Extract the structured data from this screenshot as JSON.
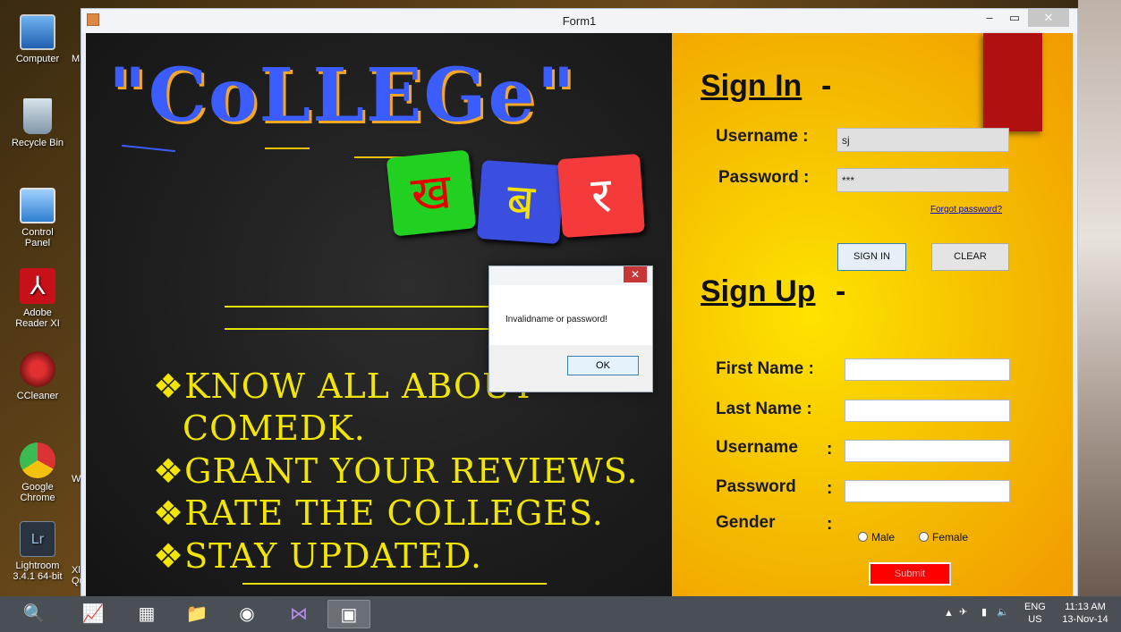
{
  "desktop": {
    "icons": [
      {
        "label": "Computer"
      },
      {
        "label": "Recycle Bin"
      },
      {
        "label": "Control Panel"
      },
      {
        "label": "Adobe Reader XI"
      },
      {
        "label": "CCleaner"
      },
      {
        "label": "Google Chrome"
      },
      {
        "label": "Lightroom 3.4.1 64-bit"
      }
    ],
    "side_labels": [
      "M",
      "W",
      "Xli",
      "Qu"
    ]
  },
  "window": {
    "title": "Form1",
    "min_label": "–",
    "max_label": "▭",
    "close_label": "✕"
  },
  "left_panel": {
    "logo_text": "\"CoLLEGe\"",
    "tiles": [
      "ख",
      "ब",
      "र"
    ],
    "features": [
      "❖KNOW ALL ABOUT",
      "COMEDK.",
      "❖GRANT YOUR REVIEWS.",
      "❖RATE THE COLLEGES.",
      "❖STAY UPDATED."
    ]
  },
  "sign_in": {
    "heading": "Sign In",
    "dash": "-",
    "username_label": "Username :",
    "username_value": "sj",
    "password_label": "Password :",
    "password_value": "***",
    "forgot_link": "Forgot password?",
    "signin_button": "SIGN IN",
    "clear_button": "CLEAR"
  },
  "sign_up": {
    "heading": "Sign Up",
    "dash": "-",
    "first_name_label": "First Name :",
    "last_name_label": "Last Name :",
    "username_label": "Username",
    "password_label": "Password",
    "gender_label": "Gender",
    "colon": ":",
    "male_label": "Male",
    "female_label": "Female",
    "submit_button": "Submit"
  },
  "dialog": {
    "message": "Invalidname or password!",
    "ok_button": "OK",
    "close_label": "✕"
  },
  "taskbar": {
    "lang": "ENG",
    "region": "US",
    "time": "11:13 AM",
    "date": "13-Nov-14"
  },
  "colors": {
    "accent_red": "#ff0000",
    "feature_yellow": "#f2e600",
    "panel_yellow": "#f6c200"
  }
}
